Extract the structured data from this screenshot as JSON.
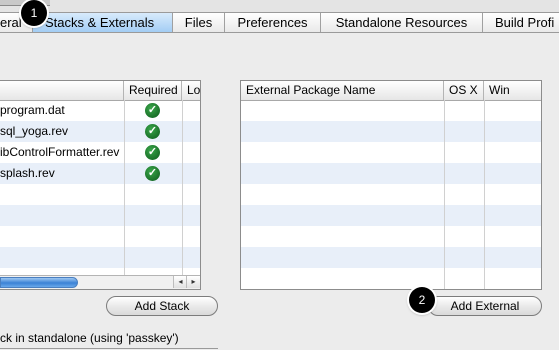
{
  "tabs": [
    {
      "label": "eral",
      "active": false
    },
    {
      "label": "Stacks & Externals",
      "active": true
    },
    {
      "label": "Files",
      "active": false
    },
    {
      "label": "Preferences",
      "active": false
    },
    {
      "label": "Standalone Resources",
      "active": false
    },
    {
      "label": "Build Profi",
      "active": false
    }
  ],
  "callouts": {
    "one": "1",
    "two": "2"
  },
  "stacks_table": {
    "headers": [
      "Required",
      "Load"
    ],
    "rows": [
      {
        "name": "program.dat",
        "required": true
      },
      {
        "name": "sql_yoga.rev",
        "required": true
      },
      {
        "name": "ibControlFormatter.rev",
        "required": true
      },
      {
        "name": "splash.rev",
        "required": true
      }
    ],
    "check_icon": "checkmark-icon",
    "scroll_left": "◂",
    "scroll_right": "▸"
  },
  "externals_table": {
    "headers": [
      "External Package Name",
      "OS X",
      "Win"
    ]
  },
  "buttons": {
    "add_stack": "Add Stack",
    "add_external": "Add External"
  },
  "footer_text": "ck in standalone (using 'passkey')",
  "colors": {
    "active_tab": "#a3cdf4",
    "row_alt": "#e8eff9",
    "check_green": "#1f7a2e"
  }
}
